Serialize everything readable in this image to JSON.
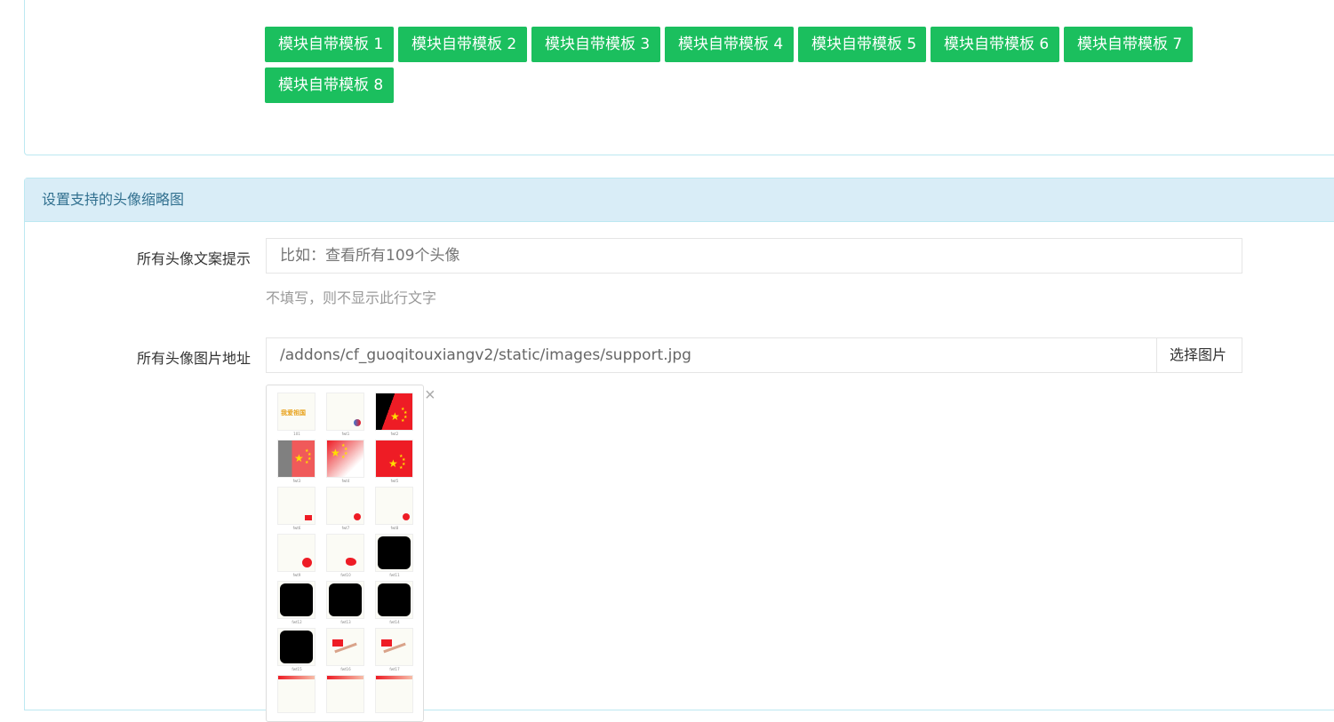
{
  "templates": {
    "buttons": [
      "模块自带模板 1",
      "模块自带模板 2",
      "模块自带模板 3",
      "模块自带模板 4",
      "模块自带模板 5",
      "模块自带模板 6",
      "模块自带模板 7",
      "模块自带模板 8"
    ]
  },
  "avatar_panel": {
    "heading": "设置支持的头像缩略图",
    "text_hint": {
      "label": "所有头像文案提示",
      "placeholder": "比如：查看所有109个头像",
      "help": "不填写，则不显示此行文字"
    },
    "image_url": {
      "label": "所有头像图片地址",
      "value": "/addons/cf_guoqitouxiangv2/static/images/support.jpg",
      "select_button": "选择图片"
    },
    "preview": {
      "close_symbol": "×",
      "first_banner": "我爱祖国",
      "items": [
        {
          "caption": "101",
          "kind": "banner"
        },
        {
          "caption": "fwt1",
          "kind": "small-badge"
        },
        {
          "caption": "fwt2",
          "kind": "red-black"
        },
        {
          "caption": "fwt3",
          "kind": "gray-red"
        },
        {
          "caption": "fwt4",
          "kind": "fade-red"
        },
        {
          "caption": "fwt5",
          "kind": "red"
        },
        {
          "caption": "fwt6",
          "kind": "small-flag"
        },
        {
          "caption": "fwt7",
          "kind": "small-circle"
        },
        {
          "caption": "fwt8",
          "kind": "small-heart"
        },
        {
          "caption": "fwt9",
          "kind": "circle"
        },
        {
          "caption": "fwt10",
          "kind": "map"
        },
        {
          "caption": "fwt11",
          "kind": "black"
        },
        {
          "caption": "fwt12",
          "kind": "black"
        },
        {
          "caption": "fwt13",
          "kind": "black"
        },
        {
          "caption": "fwt14",
          "kind": "black"
        },
        {
          "caption": "fwt15",
          "kind": "black"
        },
        {
          "caption": "fwt16",
          "kind": "hand-flag"
        },
        {
          "caption": "fwt17",
          "kind": "hand-flag"
        },
        {
          "caption": "",
          "kind": "partial"
        },
        {
          "caption": "",
          "kind": "partial"
        },
        {
          "caption": "",
          "kind": "partial"
        }
      ]
    }
  },
  "colors": {
    "button_green": "#1bbf5e",
    "panel_border": "#bce8f1",
    "panel_heading_bg": "#d9edf7",
    "panel_heading_text": "#31708f",
    "flag_red": "#ee1c25",
    "flag_star": "#ffde00"
  }
}
